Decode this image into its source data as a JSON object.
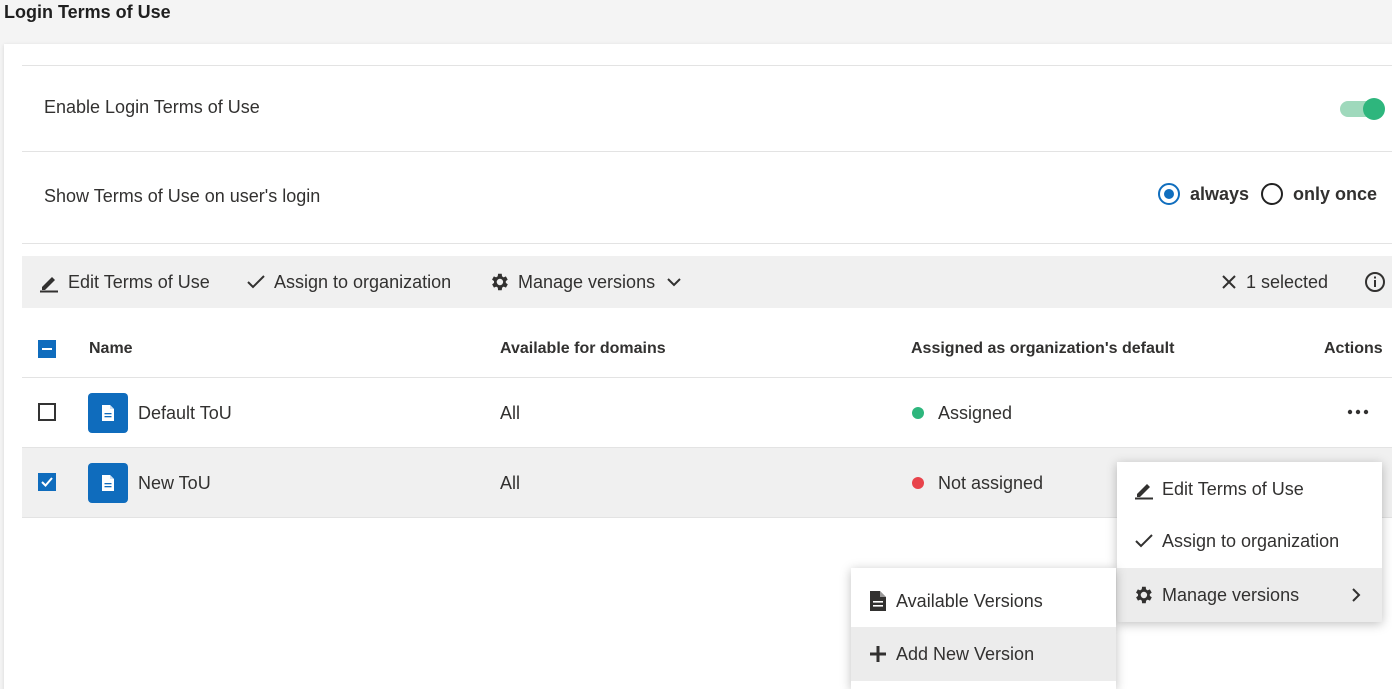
{
  "page": {
    "title": "Login Terms of Use"
  },
  "settings": {
    "enable_label": "Enable Login Terms of Use",
    "enable_on": true,
    "show_label": "Show Terms of Use on user's login",
    "options": [
      "always",
      "only once"
    ],
    "selected_option": "always"
  },
  "toolbar": {
    "edit_label": "Edit Terms of Use",
    "assign_label": "Assign to organization",
    "manage_label": "Manage versions",
    "selected_label": "1 selected"
  },
  "table": {
    "columns": [
      "Name",
      "Available for domains",
      "Assigned as organization's default",
      "Actions"
    ],
    "rows": [
      {
        "name": "Default ToU",
        "domains": "All",
        "status": "Assigned",
        "status_color": "#2eb67d",
        "checked": false
      },
      {
        "name": "New ToU",
        "domains": "All",
        "status": "Not assigned",
        "status_color": "#e8434b",
        "checked": true
      }
    ]
  },
  "context_menu": {
    "items": [
      "Edit Terms of Use",
      "Assign to organization",
      "Manage versions"
    ]
  },
  "submenu": {
    "items": [
      "Available Versions",
      "Add New Version"
    ]
  },
  "colors": {
    "accent": "#0f6cbd",
    "toggle": "#2eb67d"
  }
}
